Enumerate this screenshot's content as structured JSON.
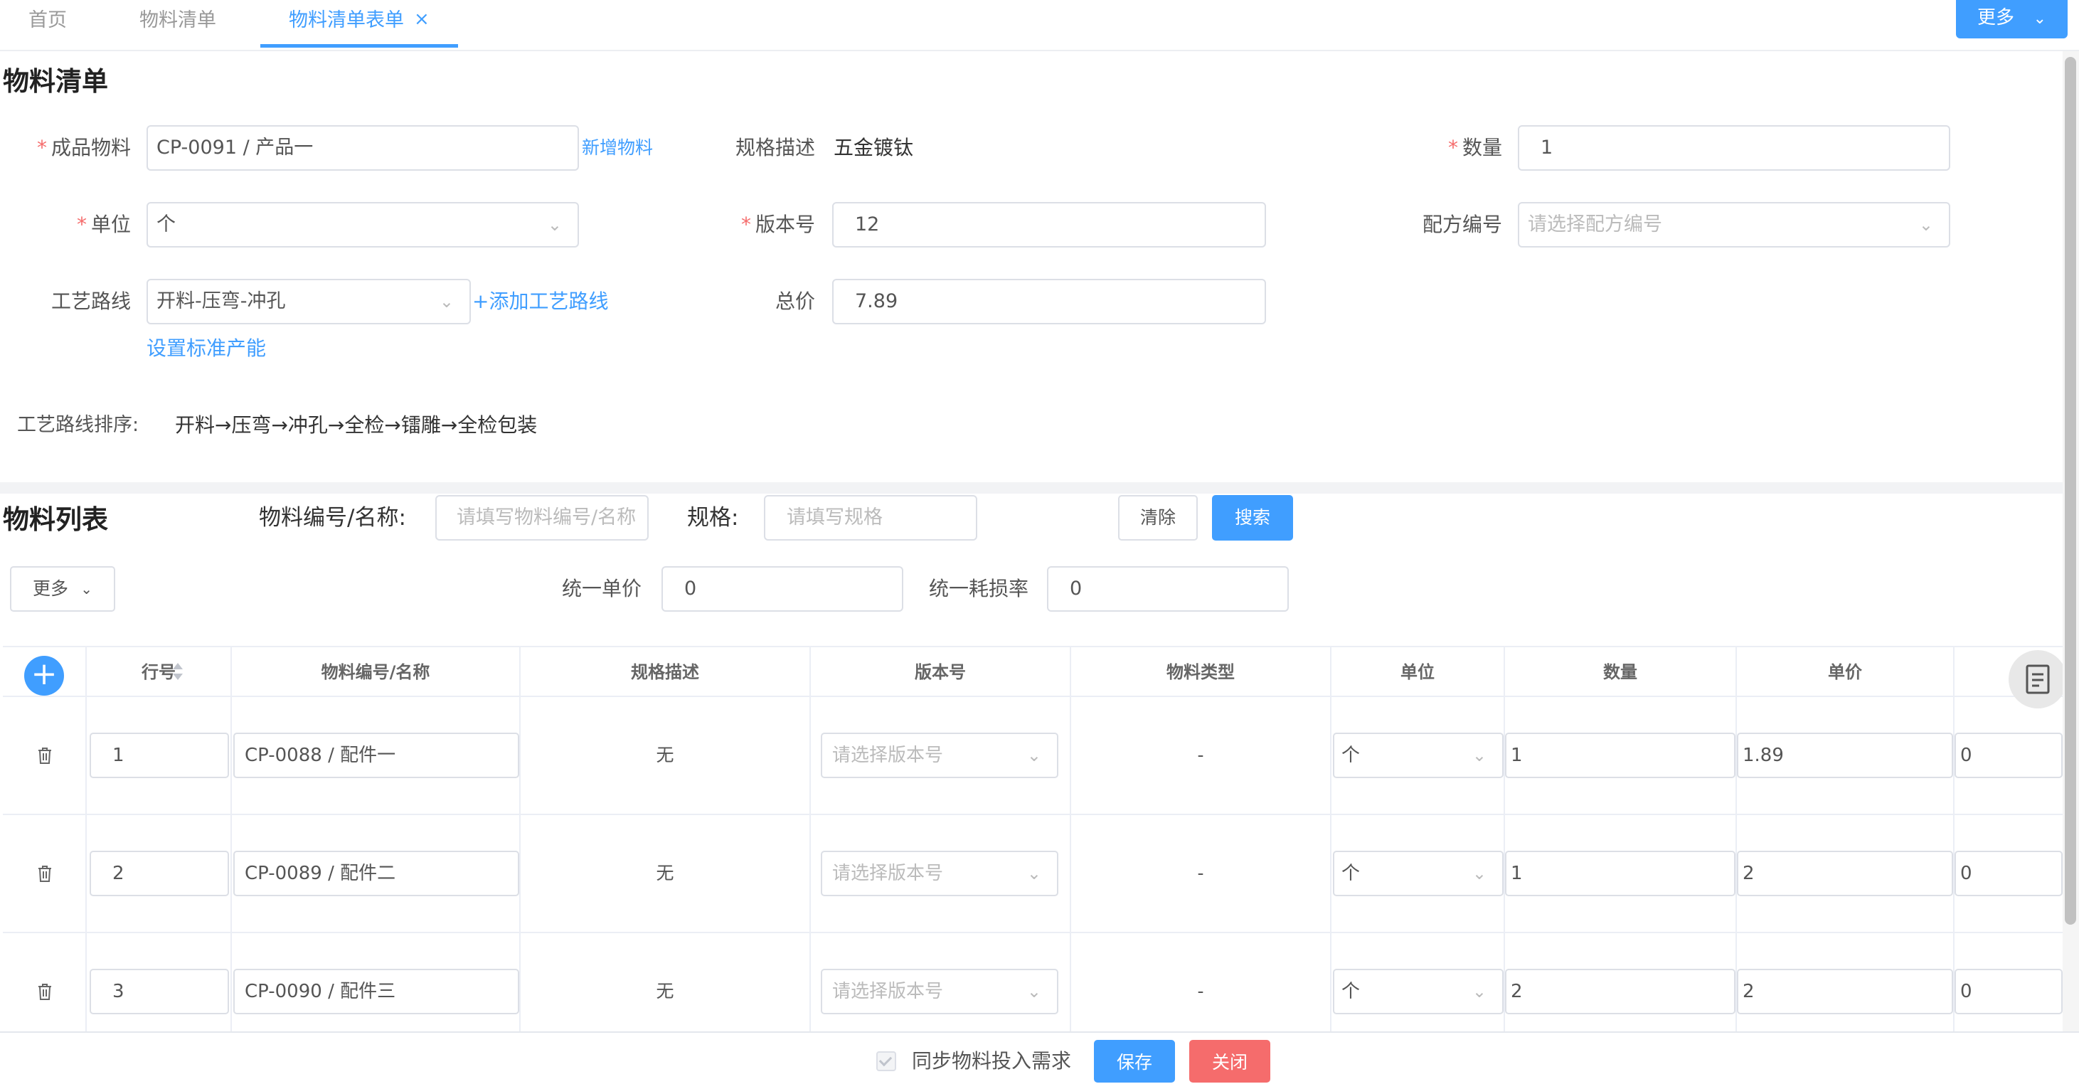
{
  "tabs": [
    {
      "label": "首页"
    },
    {
      "label": "物料清单"
    },
    {
      "label": "物料清单表单"
    }
  ],
  "tab_close": "×",
  "top_more": "更多",
  "form": {
    "title": "物料清单",
    "product_label": "成品物料",
    "product_value": "CP-0091 / 产品一",
    "add_material_link": "新增物料",
    "spec_label": "规格描述",
    "spec_value": "五金镀钛",
    "qty_label": "数量",
    "qty_value": "1",
    "unit_label": "单位",
    "unit_value": "个",
    "version_label": "版本号",
    "version_value": "12",
    "formula_label": "配方编号",
    "formula_placeholder": "请选择配方编号",
    "route_label": "工艺路线",
    "route_value": "开料-压弯-冲孔",
    "add_route_link": "+添加工艺路线",
    "total_label": "总价",
    "total_value": "7.89",
    "std_capacity_link": "设置标准产能",
    "route_order_label": "工艺路线排序:",
    "route_order_value": "开料→压弯→冲孔→全检→镭雕→全检包装"
  },
  "list": {
    "title": "物料列表",
    "search_code_label": "物料编号/名称:",
    "search_code_placeholder": "请填写物料编号/名称",
    "search_spec_label": "规格:",
    "search_spec_placeholder": "请填写规格",
    "clear_button": "清除",
    "search_button": "搜索",
    "more_button": "更多",
    "unit_price_label": "统一单价",
    "unit_price_value": "0",
    "loss_rate_label": "统一耗损率",
    "loss_rate_value": "0"
  },
  "table": {
    "add": "+",
    "columns": [
      "行号",
      "物料编号/名称",
      "规格描述",
      "版本号",
      "物料类型",
      "单位",
      "数量",
      "单价"
    ],
    "version_placeholder": "请选择版本号",
    "rows": [
      {
        "line": "1",
        "code": "CP-0088 / 配件一",
        "spec": "无",
        "type": "-",
        "unit": "个",
        "qty": "1",
        "price": "1.89",
        "extra": "0"
      },
      {
        "line": "2",
        "code": "CP-0089 / 配件二",
        "spec": "无",
        "type": "-",
        "unit": "个",
        "qty": "1",
        "price": "2",
        "extra": "0"
      },
      {
        "line": "3",
        "code": "CP-0090 / 配件三",
        "spec": "无",
        "type": "-",
        "unit": "个",
        "qty": "2",
        "price": "2",
        "extra": "0"
      }
    ]
  },
  "footer": {
    "sync_label": "同步物料投入需求",
    "save_button": "保存",
    "close_button": "关闭"
  },
  "colors": {
    "primary": "#409eff",
    "danger": "#f56c6c",
    "required": "#f56c6c"
  }
}
